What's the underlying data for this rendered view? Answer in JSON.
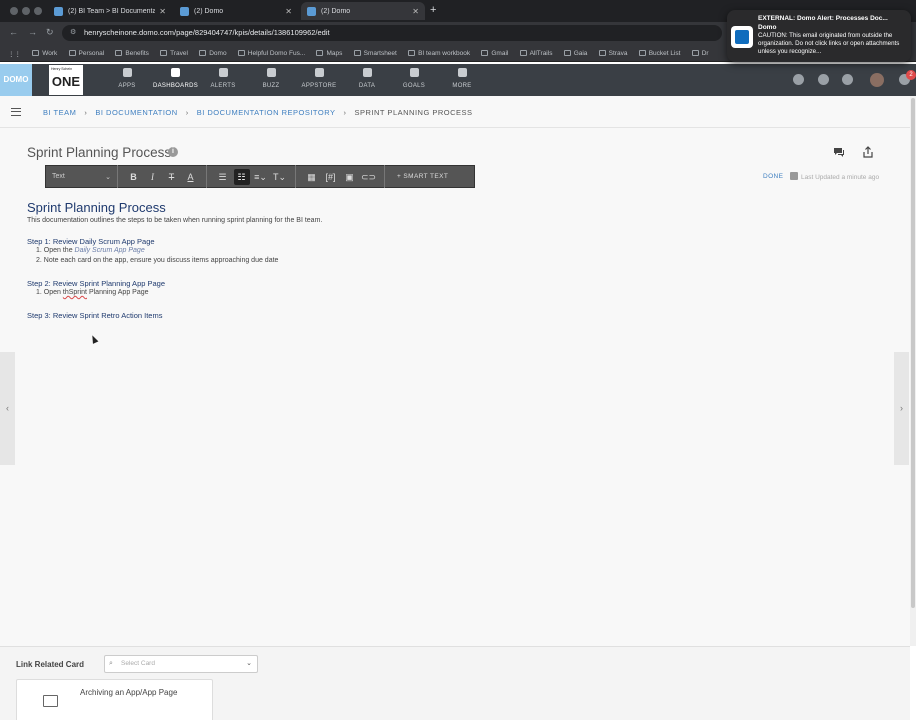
{
  "browser": {
    "tabs": [
      {
        "label": "(2) BI Team > BI Documentati"
      },
      {
        "label": "(2) Domo"
      },
      {
        "label": "(2) Domo"
      }
    ],
    "url": "henryscheinone.domo.com/page/829404747/kpis/details/1386109962/edit",
    "bookmarks": [
      "Work",
      "Personal",
      "Benefits",
      "Travel",
      "Domo",
      "Helpful Domo Fus...",
      "Maps",
      "Smartsheet",
      "BI team workbook",
      "Gmail",
      "AllTrails",
      "Gaia",
      "Strava",
      "Bucket List",
      "Dr"
    ]
  },
  "notification": {
    "title": "EXTERNAL: Domo Alert: Processes Doc...",
    "sender": "Domo",
    "body": "CAUTION: This email originated from outside the organization. Do not click links or open attachments unless you recognize..."
  },
  "header": {
    "domo_logo": "DOMO",
    "one_logo": "ONE",
    "one_logo_small": "Henry Schein",
    "nav": [
      {
        "label": "APPS",
        "icon": "apps-icon"
      },
      {
        "label": "DASHBOARDS",
        "icon": "dashboards-icon"
      },
      {
        "label": "ALERTS",
        "icon": "alerts-icon"
      },
      {
        "label": "BUZZ",
        "icon": "buzz-icon"
      },
      {
        "label": "APPSTORE",
        "icon": "appstore-icon"
      },
      {
        "label": "DATA",
        "icon": "data-icon"
      },
      {
        "label": "GOALS",
        "icon": "goals-icon"
      },
      {
        "label": "MORE",
        "icon": "more-icon"
      }
    ],
    "notification_count": "2"
  },
  "breadcrumb": [
    "BI TEAM",
    "BI DOCUMENTATION",
    "BI DOCUMENTATION REPOSITORY",
    "SPRINT PLANNING PROCESS"
  ],
  "page": {
    "title": "Sprint Planning Process",
    "info_glyph": "i",
    "done_label": "DONE",
    "last_updated": "Last Updated a minute ago"
  },
  "toolbar": {
    "style_select": "Text",
    "smart_text_label": "SMART TEXT"
  },
  "doc": {
    "heading": "Sprint Planning Process",
    "intro": "This documentation outlines the steps to be taken when running sprint planning for the BI team.",
    "step1": {
      "title": "Step 1: Review Daily Scrum App Page",
      "item1_prefix": "1. Open the",
      "item1_link": "Daily Scrum App Page",
      "item2": "2. Note each card on the app, ensure you discuss items approaching due date"
    },
    "step2": {
      "title": "Step 2: Review Sprint Planning App Page",
      "item1_prefix": "1. Open",
      "item1_typo": "thSprint",
      "item1_rest": "Planning App Page"
    },
    "step3": {
      "title": "Step 3: Review Sprint Retro Action Items"
    }
  },
  "footer": {
    "link_related_label": "Link Related Card",
    "select_placeholder": "Select Card",
    "related_card_title": "Archiving an App/App Page"
  }
}
